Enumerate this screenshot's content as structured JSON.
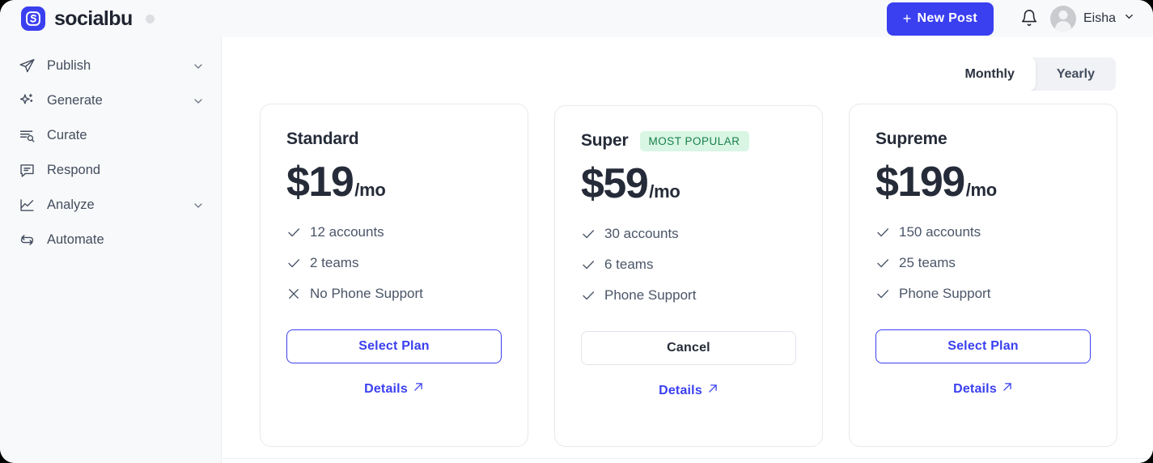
{
  "header": {
    "brand_name": "socialbu",
    "logo_icon": "socialbu-logo-icon",
    "status_dot_icon": "status-dot-icon",
    "new_post_label": "New Post",
    "plus_icon": "plus-icon",
    "bell_icon": "bell-icon",
    "avatar_icon": "avatar-icon",
    "user_name": "Eisha",
    "chevron_icon": "chevron-down-icon"
  },
  "sidebar": {
    "items": [
      {
        "label": "Publish",
        "icon": "send-icon",
        "has_chevron": true
      },
      {
        "label": "Generate",
        "icon": "sparkles-icon",
        "has_chevron": true
      },
      {
        "label": "Curate",
        "icon": "list-search-icon",
        "has_chevron": false
      },
      {
        "label": "Respond",
        "icon": "message-icon",
        "has_chevron": false
      },
      {
        "label": "Analyze",
        "icon": "line-chart-icon",
        "has_chevron": true
      },
      {
        "label": "Automate",
        "icon": "repeat-icon",
        "has_chevron": false
      }
    ]
  },
  "billing_toggle": {
    "options": [
      {
        "label": "Monthly",
        "active": true
      },
      {
        "label": "Yearly",
        "active": false
      }
    ]
  },
  "plans": [
    {
      "name": "Standard",
      "badge": "",
      "price_amount": "$19",
      "price_period": "/mo",
      "features": [
        {
          "text": "12 accounts",
          "icon": "check-icon",
          "included": true
        },
        {
          "text": "2 teams",
          "icon": "check-icon",
          "included": true
        },
        {
          "text": "No Phone Support",
          "icon": "close-icon",
          "included": false
        }
      ],
      "cta_label": "Select Plan",
      "cta_style": "primary",
      "details_label": "Details",
      "details_icon": "arrow-up-right-icon"
    },
    {
      "name": "Super",
      "badge": "MOST POPULAR",
      "price_amount": "$59",
      "price_period": "/mo",
      "features": [
        {
          "text": "30 accounts",
          "icon": "check-icon",
          "included": true
        },
        {
          "text": "6 teams",
          "icon": "check-icon",
          "included": true
        },
        {
          "text": "Phone Support",
          "icon": "check-icon",
          "included": true
        }
      ],
      "cta_label": "Cancel",
      "cta_style": "neutral",
      "details_label": "Details",
      "details_icon": "arrow-up-right-icon"
    },
    {
      "name": "Supreme",
      "badge": "",
      "price_amount": "$199",
      "price_period": "/mo",
      "features": [
        {
          "text": "150 accounts",
          "icon": "check-icon",
          "included": true
        },
        {
          "text": "25 teams",
          "icon": "check-icon",
          "included": true
        },
        {
          "text": "Phone Support",
          "icon": "check-icon",
          "included": true
        }
      ],
      "cta_label": "Select Plan",
      "cta_style": "primary",
      "details_label": "Details",
      "details_icon": "arrow-up-right-icon"
    }
  ],
  "colors": {
    "brand_blue": "#3a3ff0",
    "badge_bg": "#d9f6e4",
    "badge_text": "#17804a",
    "sidebar_bg": "#f8f9fa",
    "text_dark": "#252b38",
    "text_muted": "#4a5568"
  }
}
